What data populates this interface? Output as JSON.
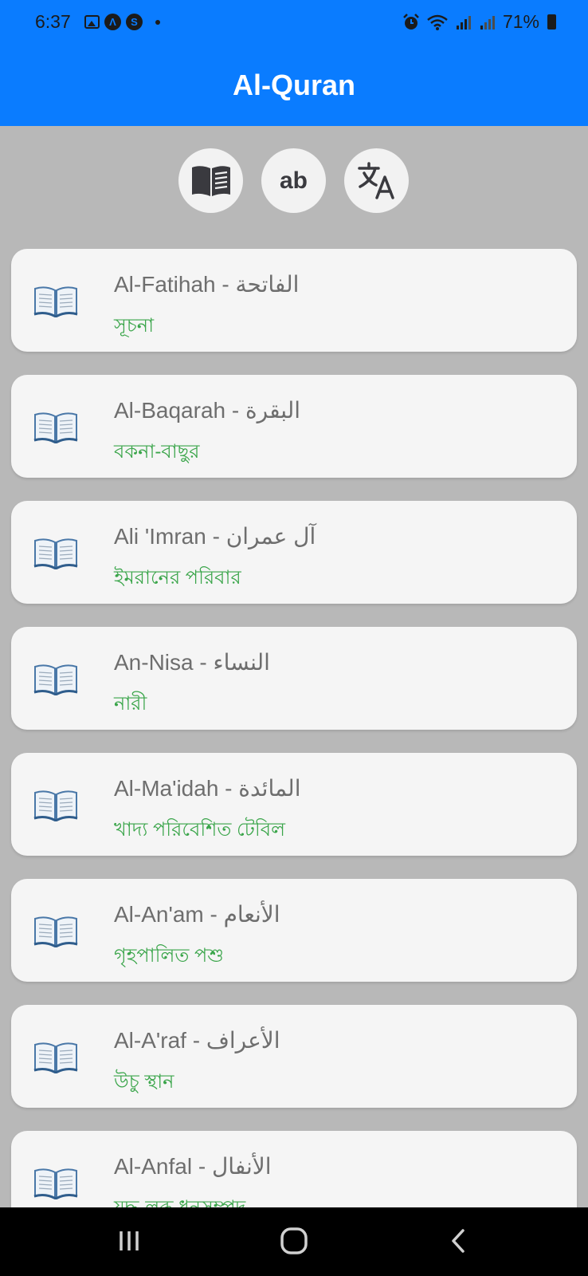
{
  "status": {
    "time": "6:37",
    "badge_a": "Λ",
    "badge_s": "S",
    "battery": "71%"
  },
  "app": {
    "title": "Al-Quran"
  },
  "modes": [
    {
      "icon": "reading-icon"
    },
    {
      "label": "ab",
      "icon": "transliteration-icon"
    },
    {
      "icon": "translate-icon"
    }
  ],
  "surahs": [
    {
      "name": "Al-Fatihah - الفاتحة",
      "meaning": "সূচনা"
    },
    {
      "name": "Al-Baqarah - البقرة",
      "meaning": "বকনা-বাছুর"
    },
    {
      "name": "Ali 'Imran - آل عمران",
      "meaning": "ইমরানের পরিবার"
    },
    {
      "name": "An-Nisa - النساء",
      "meaning": "নারী"
    },
    {
      "name": "Al-Ma'idah - المائدة",
      "meaning": "খাদ্য পরিবেশিত টেবিল"
    },
    {
      "name": "Al-An'am - الأنعام",
      "meaning": "গৃহপালিত পশু"
    },
    {
      "name": "Al-A'raf - الأعراف",
      "meaning": "উচু স্থান"
    },
    {
      "name": "Al-Anfal - الأنفال",
      "meaning": "যুদ্ধ-লব্ধ ধনসম্পদ"
    }
  ],
  "colors": {
    "primary": "#0a7cff",
    "meaning_text": "#3aa54a",
    "background": "#b8b8b8"
  }
}
